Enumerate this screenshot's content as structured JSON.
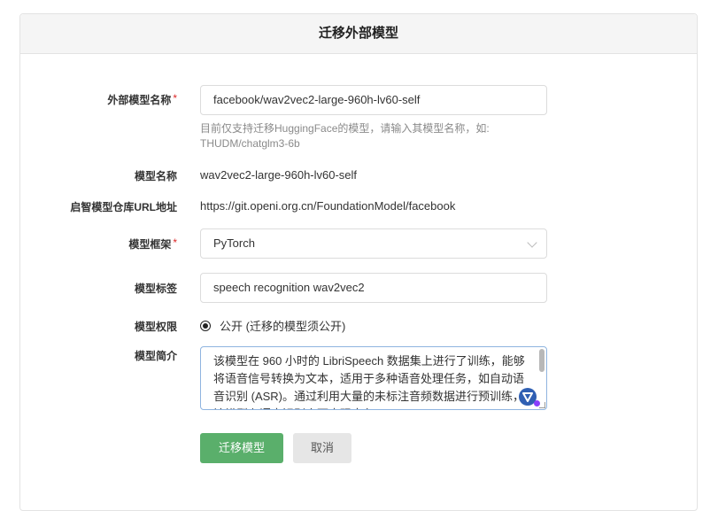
{
  "dialog": {
    "title": "迁移外部模型"
  },
  "form": {
    "external_name": {
      "label": "外部模型名称",
      "required_mark": "*",
      "value": "facebook/wav2vec2-large-960h-lv60-self",
      "hint": "目前仅支持迁移HuggingFace的模型，请输入其模型名称，如: THUDM/chatglm3-6b"
    },
    "model_name": {
      "label": "模型名称",
      "value": "wav2vec2-large-960h-lv60-self"
    },
    "repo_url": {
      "label": "启智模型仓库URL地址",
      "value": "https://git.openi.org.cn/FoundationModel/facebook"
    },
    "framework": {
      "label": "模型框架",
      "required_mark": "*",
      "value": "PyTorch"
    },
    "tags": {
      "label": "模型标签",
      "value": "speech recognition wav2vec2"
    },
    "permission": {
      "label": "模型权限",
      "option": "公开 (迁移的模型须公开)"
    },
    "description": {
      "label": "模型简介",
      "value": "该模型在 960 小时的 LibriSpeech 数据集上进行了训练，能够将语音信号转换为文本，适用于多种语音处理任务，如自动语音识别 (ASR)。通过利用大量的未标注音频数据进行预训练，该模型在语音识别方面表现出色。"
    }
  },
  "buttons": {
    "submit": "迁移模型",
    "cancel": "取消"
  },
  "colors": {
    "primary": "#5aaf6b",
    "required": "#db2828",
    "focus_border": "#8fb4e0"
  }
}
